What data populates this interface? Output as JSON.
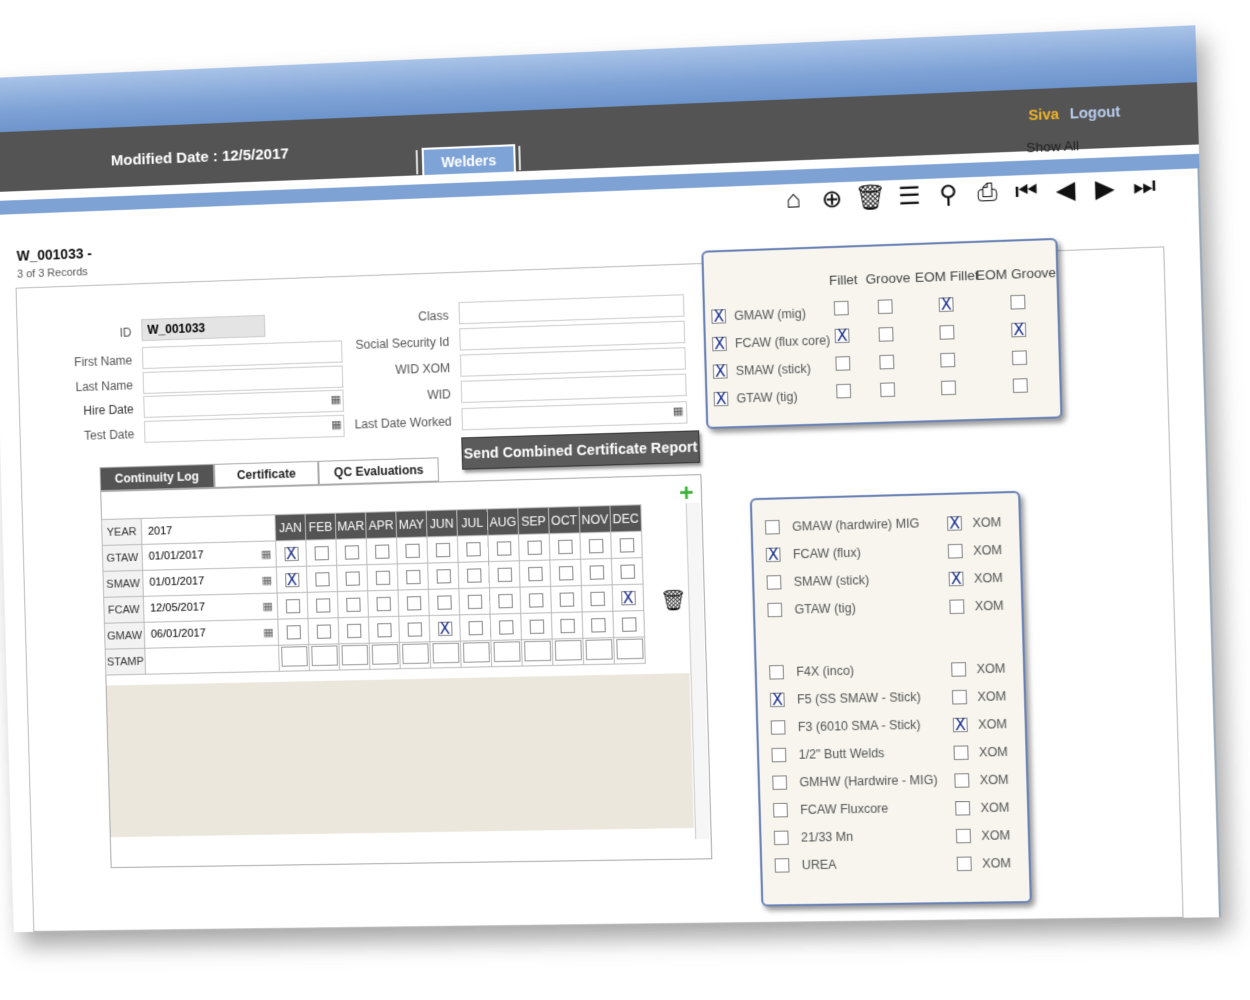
{
  "header": {
    "modified_label": "Modified Date : 12/5/2017",
    "tab": "Welders",
    "user": "Siva",
    "logout": "Logout",
    "show_all": "Show All"
  },
  "toolbar": [
    "home-icon",
    "add-icon",
    "delete-icon",
    "list-icon",
    "search-icon",
    "print-icon",
    "first-icon",
    "prev-icon",
    "next-icon",
    "last-icon"
  ],
  "record": {
    "id": "W_001033 -",
    "count": "3 of 3 Records"
  },
  "form": {
    "id_label": "ID",
    "id_value": "W_001033",
    "first_name": "First Name",
    "last_name": "Last Name",
    "hire_date": "Hire Date",
    "test_date": "Test Date",
    "class": "Class",
    "ssn": "Social Security Id",
    "wid_xom": "WID XOM",
    "wid": "WID",
    "last_date_worked": "Last Date Worked",
    "send_button": "Send Combined Certificate Report"
  },
  "tabs": [
    "Continuity Log",
    "Certificate",
    "QC Evaluations"
  ],
  "log": {
    "year_label": "YEAR",
    "year": "2017",
    "months": [
      "JAN",
      "FEB",
      "MAR",
      "APR",
      "MAY",
      "JUN",
      "JUL",
      "AUG",
      "SEP",
      "OCT",
      "NOV",
      "DEC"
    ],
    "rows": [
      {
        "label": "GTAW",
        "date": "01/01/2017",
        "checked": [
          0
        ]
      },
      {
        "label": "SMAW",
        "date": "01/01/2017",
        "checked": [
          0
        ]
      },
      {
        "label": "FCAW",
        "date": "12/05/2017",
        "checked": [
          11
        ]
      },
      {
        "label": "GMAW",
        "date": "06/01/2017",
        "checked": [
          5
        ]
      }
    ],
    "stamp_label": "STAMP"
  },
  "process_panel": {
    "columns": [
      "Fillet",
      "Groove",
      "EOM Fillet",
      "EOM Groove"
    ],
    "rows": [
      {
        "label": "GMAW (mig)",
        "main": true,
        "cols": [
          false,
          false,
          true,
          false
        ]
      },
      {
        "label": "FCAW (flux core)",
        "main": true,
        "cols": [
          true,
          false,
          false,
          true
        ]
      },
      {
        "label": "SMAW (stick)",
        "main": true,
        "cols": [
          false,
          false,
          false,
          false
        ]
      },
      {
        "label": "GTAW (tig)",
        "main": true,
        "cols": [
          false,
          false,
          false,
          false
        ]
      }
    ]
  },
  "cert_panel": {
    "group1": [
      {
        "label": "GMAW (hardwire) MIG",
        "checked": false,
        "xom": true
      },
      {
        "label": "FCAW (flux)",
        "checked": true,
        "xom": false
      },
      {
        "label": "SMAW (stick)",
        "checked": false,
        "xom": true
      },
      {
        "label": "GTAW (tig)",
        "checked": false,
        "xom": false
      }
    ],
    "group2": [
      {
        "label": "F4X (inco)",
        "checked": false,
        "xom": false
      },
      {
        "label": "F5 (SS SMAW - Stick)",
        "checked": true,
        "xom": false
      },
      {
        "label": "F3 (6010 SMA - Stick)",
        "checked": false,
        "xom": true
      },
      {
        "label": "1/2\" Butt Welds",
        "checked": false,
        "xom": false
      },
      {
        "label": "GMHW (Hardwire - MIG)",
        "checked": false,
        "xom": false
      },
      {
        "label": "FCAW Fluxcore",
        "checked": false,
        "xom": false
      },
      {
        "label": "21/33 Mn",
        "checked": false,
        "xom": false
      },
      {
        "label": "UREA",
        "checked": false,
        "xom": false
      }
    ],
    "xom_label": "XOM"
  }
}
